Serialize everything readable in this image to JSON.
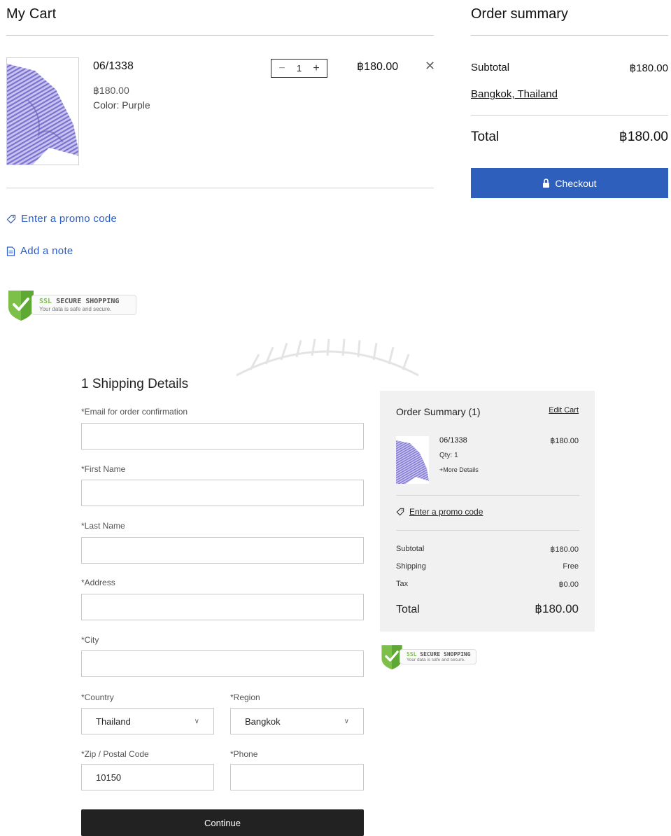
{
  "cart": {
    "title": "My Cart",
    "item": {
      "name": "06/1338",
      "price": "฿180.00",
      "color": "Color: Purple",
      "quantity": "1",
      "minus": "−",
      "plus": "+",
      "line_total": "฿180.00",
      "remove": "✕"
    },
    "promo_label": "Enter a promo code",
    "note_label": "Add a note"
  },
  "ssl_badge": {
    "ssl": "SSL",
    "title": "SECURE SHOPPING",
    "subtitle": "Your data is safe and secure."
  },
  "order_summary": {
    "title": "Order summary",
    "subtotal_label": "Subtotal",
    "subtotal_value": "฿180.00",
    "location": "Bangkok, Thailand",
    "total_label": "Total",
    "total_value": "฿180.00",
    "checkout_label": "Checkout"
  },
  "shipping": {
    "title": "1  Shipping Details",
    "email_label": "*Email for order confirmation",
    "email_value": "",
    "first_name_label": "*First Name",
    "first_name_value": "",
    "last_name_label": "*Last Name",
    "last_name_value": "",
    "address_label": "*Address",
    "address_value": "",
    "city_label": "*City",
    "city_value": "",
    "country_label": "*Country",
    "country_value": "Thailand",
    "region_label": "*Region",
    "region_value": "Bangkok",
    "zip_label": "*Zip / Postal Code",
    "zip_value": "10150",
    "phone_label": "*Phone",
    "phone_value": "",
    "continue_label": "Continue"
  },
  "summary_panel": {
    "title": "Order Summary (1)",
    "edit_cart": "Edit Cart",
    "item_name": "06/1338",
    "item_price": "฿180.00",
    "item_qty": "Qty: 1",
    "more_details": "+More Details",
    "promo_label": "Enter a promo code",
    "subtotal_label": "Subtotal",
    "subtotal_value": "฿180.00",
    "shipping_label": "Shipping",
    "shipping_value": "Free",
    "tax_label": "Tax",
    "tax_value": "฿0.00",
    "total_label": "Total",
    "total_value": "฿180.00"
  },
  "icons": {
    "tag": "tag-icon",
    "note": "note-icon",
    "lock": "lock-icon",
    "chevron": "chevron-down-icon",
    "shield": "shield-check-icon"
  },
  "colors": {
    "link_blue": "#2c5cc5",
    "checkout_blue": "#2f5fbd",
    "product_purple": "#8f86d8",
    "continue_dark": "#222222",
    "panel_grey": "#f1f1f1",
    "shield_green": "#7cc04a"
  }
}
